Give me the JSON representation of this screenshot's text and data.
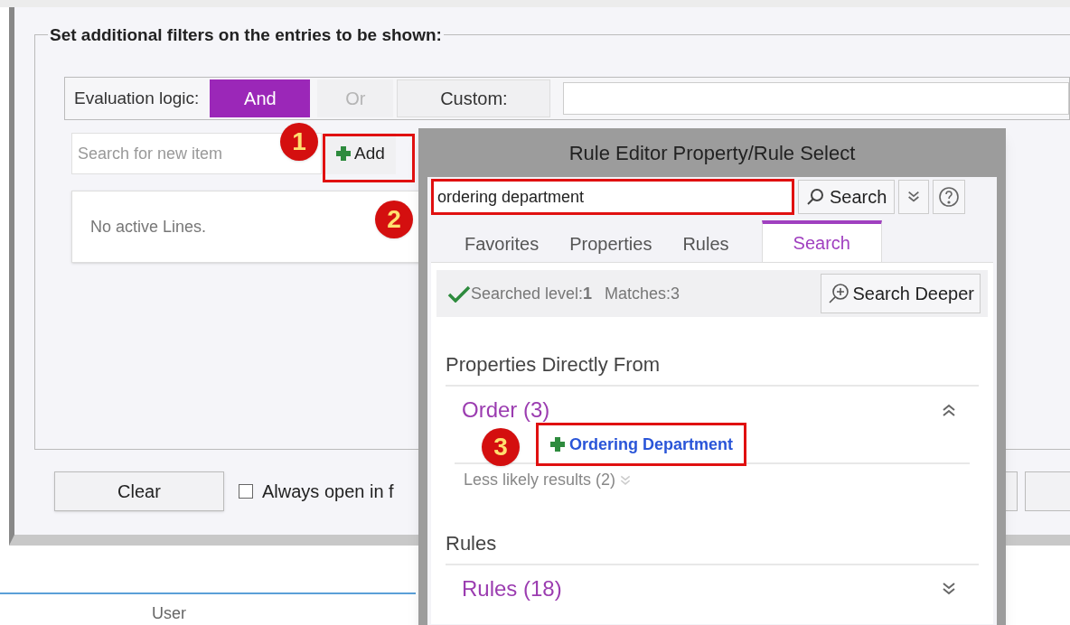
{
  "filters": {
    "legend": "Set additional filters on the entries to be shown:",
    "evaluation": {
      "label": "Evaluation logic:",
      "options": [
        {
          "label": "And",
          "selected": true
        },
        {
          "label": "Or",
          "selected": false
        }
      ],
      "custom_label": "Custom:"
    },
    "search": {
      "placeholder": "Search for new item"
    },
    "add_button": "Add",
    "empty_text": "No active Lines."
  },
  "bottom": {
    "clear_button": "Clear",
    "checkbox": {
      "label": "Always open in f",
      "checked": false
    }
  },
  "table": {
    "columns": [
      "User"
    ]
  },
  "popup": {
    "title": "Rule Editor Property/Rule Select",
    "search_value": "ordering department",
    "search_button": "Search",
    "tabs": [
      {
        "label": "Favorites",
        "selected": false
      },
      {
        "label": "Properties",
        "selected": false
      },
      {
        "label": "Rules",
        "selected": false
      },
      {
        "label": "Search",
        "selected": true
      }
    ],
    "status": {
      "level": "Searched level:**1**",
      "matches": "Matches:3",
      "deeper_button": "Search Deeper"
    },
    "sections": [
      {
        "title": "Properties Directly From",
        "groups": [
          {
            "title": "Order (3)",
            "expanded": true,
            "items": [
              "Ordering Department"
            ],
            "more": "Less likely results (2)"
          }
        ]
      },
      {
        "title": "Rules",
        "groups": [
          {
            "title": "Rules (18)",
            "expanded": false
          }
        ]
      }
    ]
  },
  "markers": [
    {
      "text": "1"
    },
    {
      "text": "2"
    },
    {
      "text": "3"
    }
  ]
}
